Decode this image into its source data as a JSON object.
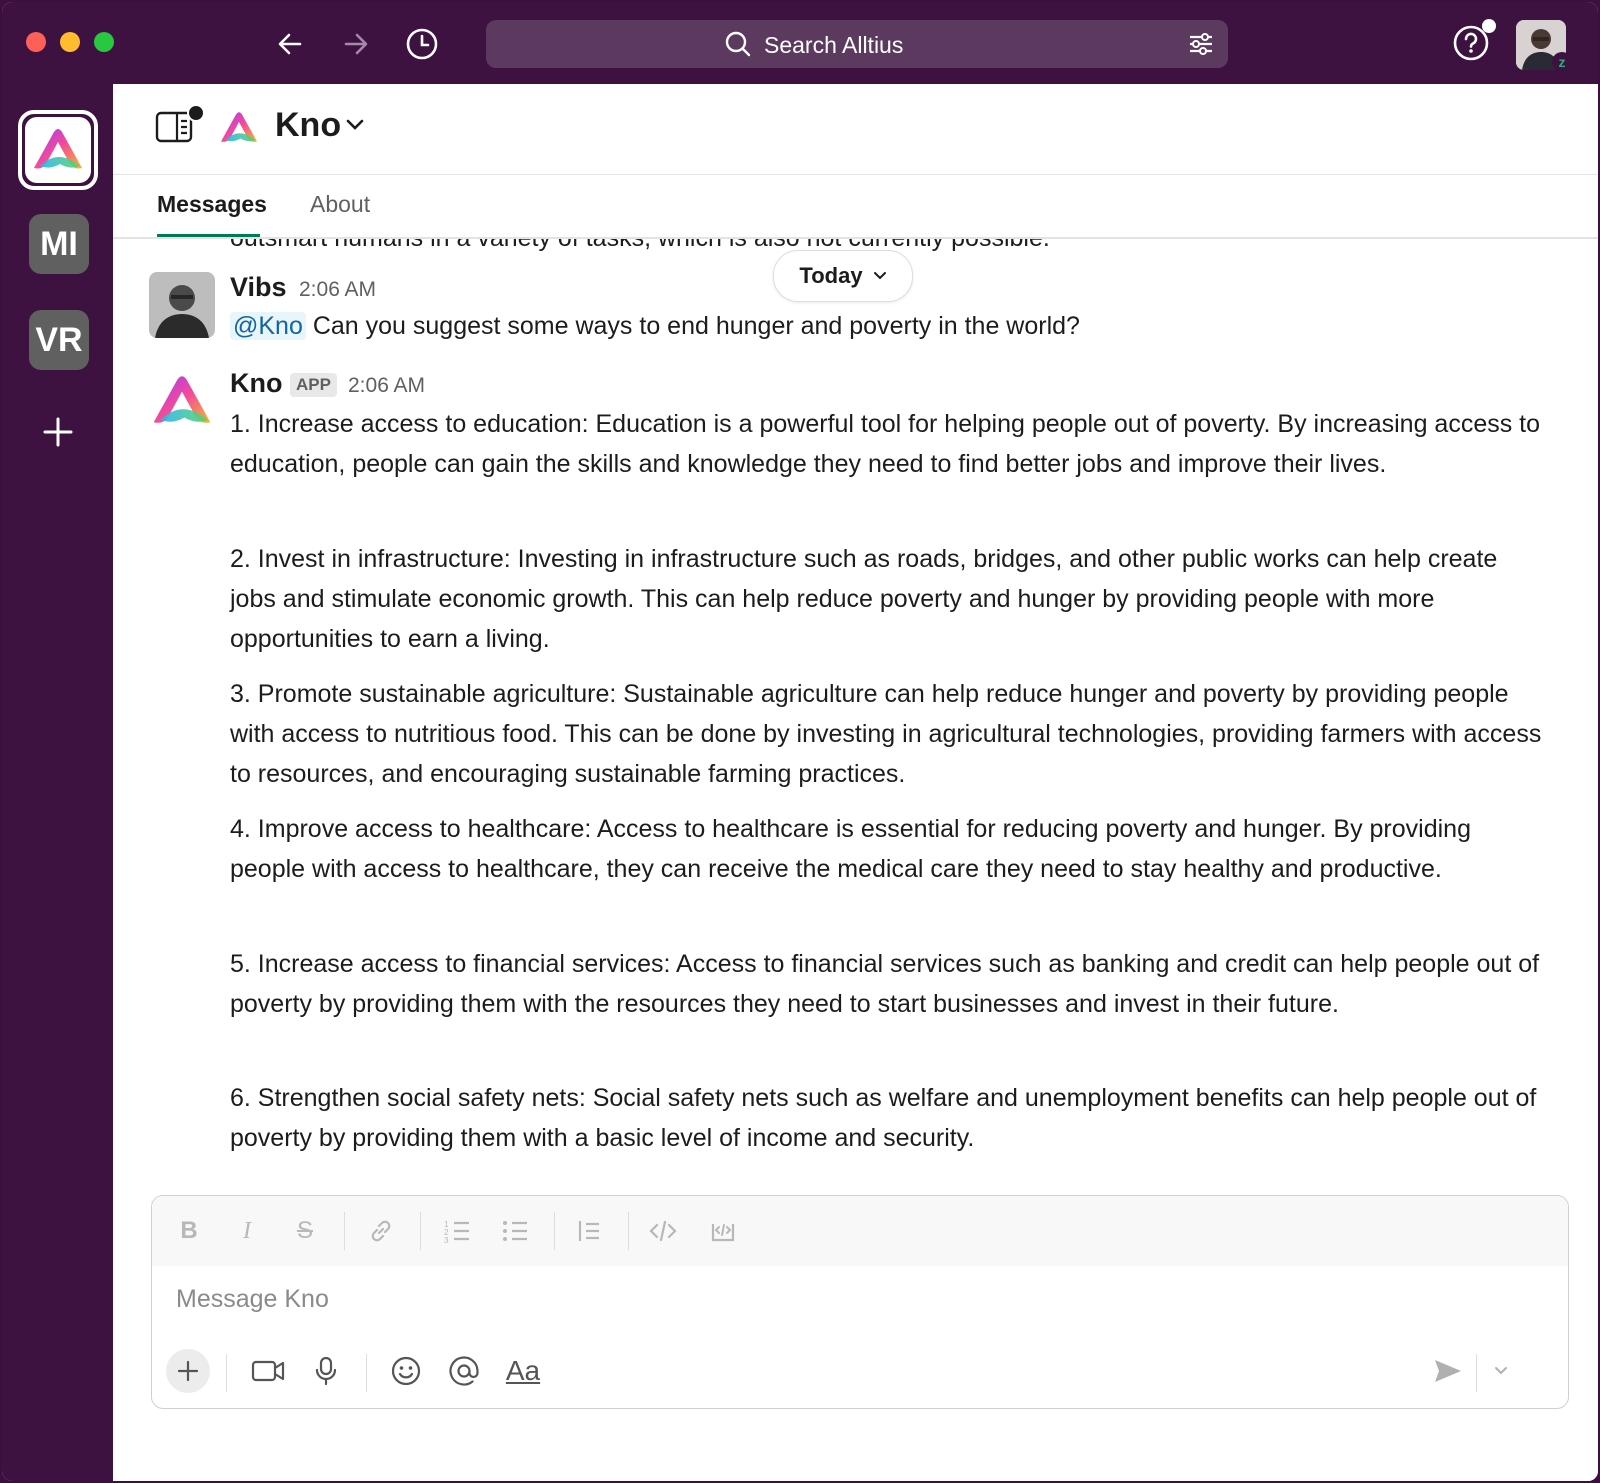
{
  "titlebar": {
    "search_label": "Search Alltius"
  },
  "rail": {
    "workspaces": [
      {
        "label": "MI"
      },
      {
        "label": "VR"
      }
    ]
  },
  "channel": {
    "name": "Kno",
    "tabs": [
      {
        "label": "Messages"
      },
      {
        "label": "About"
      }
    ]
  },
  "feed": {
    "clipped_text": "outsmart humans in a variety of tasks, which is also not currently possible.",
    "date_divider": "Today",
    "messages": [
      {
        "author": "Vibs",
        "time": "2:06 AM",
        "mention": "@Kno",
        "text": "Can you suggest some ways to end hunger and poverty in the world?"
      },
      {
        "author": "Kno",
        "badge": "APP",
        "time": "2:06 AM",
        "paragraphs": [
          "1. Increase access to education: Education is a powerful tool for helping people out of poverty. By increasing access to education, people can gain the skills and knowledge they need to find better jobs and improve their lives.",
          "2. Invest in infrastructure: Investing in infrastructure such as roads, bridges, and other public works can help create jobs and stimulate economic growth. This can help reduce poverty and hunger by providing people with more opportunities to earn a living.",
          "3. Promote sustainable agriculture: Sustainable agriculture can help reduce hunger and poverty by providing people with access to nutritious food. This can be done by investing in agricultural technologies, providing farmers with access to resources, and encouraging sustainable farming practices.",
          "4. Improve access to healthcare: Access to healthcare is essential for reducing poverty and hunger. By providing people with access to healthcare, they can receive the medical care they need to stay healthy and productive.",
          "5. Increase access to financial services: Access to financial services such as banking and credit can help people out of poverty by providing them with the resources they need to start businesses and invest in their future.",
          "6. Strengthen social safety nets: Social safety nets such as welfare and unemployment benefits can help people out of poverty by providing them with a basic level of income and security."
        ]
      }
    ]
  },
  "composer": {
    "placeholder": "Message Kno",
    "format_label": "Aa"
  },
  "colors": {
    "sidebar": "#3d1140",
    "accent_green": "#007a5a",
    "mention_bg": "#e8f5fa",
    "mention_text": "#1264a3"
  },
  "icons": [
    "back-arrow-icon",
    "forward-arrow-icon",
    "history-icon",
    "search-icon",
    "filter-icon",
    "help-icon",
    "panel-icon",
    "kno-logo-icon",
    "chevron-down-icon",
    "plus-icon",
    "bold-icon",
    "italic-icon",
    "strikethrough-icon",
    "link-icon",
    "ordered-list-icon",
    "bullet-list-icon",
    "blockquote-icon",
    "code-icon",
    "code-block-icon",
    "video-icon",
    "mic-icon",
    "emoji-icon",
    "mention-icon",
    "send-icon"
  ]
}
